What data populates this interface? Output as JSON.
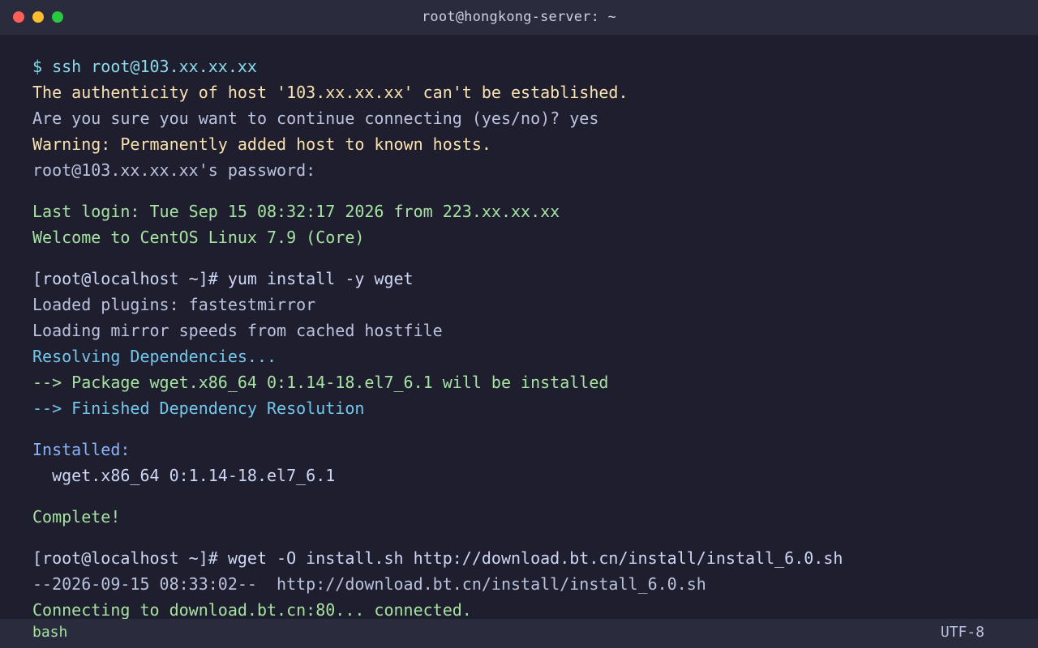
{
  "window": {
    "title": "root@hongkong-server: ~",
    "controls": {
      "close_color": "#ff5f57",
      "minimize_color": "#febc2e",
      "maximize_color": "#28c840"
    }
  },
  "terminal": {
    "lines": [
      {
        "text": "$ ssh root@103.xx.xx.xx",
        "style": "prompt"
      },
      {
        "text": "The authenticity of host '103.xx.xx.xx' can't be established.",
        "style": "warn"
      },
      {
        "text": "Are you sure you want to continue connecting (yes/no)? yes",
        "style": "normal"
      },
      {
        "text": "Warning: Permanently added host to known hosts.",
        "style": "warn"
      },
      {
        "text": "root@103.xx.xx.xx's password:",
        "style": "normal"
      },
      {
        "text": "Last login: Tue Sep 15 08:32:17 2026 from 223.xx.xx.xx",
        "style": "ok",
        "gap": true
      },
      {
        "text": "Welcome to CentOS Linux 7.9 (Core)",
        "style": "ok"
      },
      {
        "text": "[root@localhost ~]# yum install -y wget",
        "style": "cmd",
        "gap": true
      },
      {
        "text": "Loaded plugins: fastestmirror",
        "style": "normal"
      },
      {
        "text": "Loading mirror speeds from cached hostfile",
        "style": "normal"
      },
      {
        "text": "Resolving Dependencies...",
        "style": "info"
      },
      {
        "text": "--> Package wget.x86_64 0:1.14-18.el7_6.1 will be installed",
        "style": "ok"
      },
      {
        "text": "--> Finished Dependency Resolution",
        "style": "info"
      },
      {
        "text": "Installed:",
        "style": "head",
        "gap": true
      },
      {
        "text": "  wget.x86_64 0:1.14-18.el7_6.1",
        "style": "cmd"
      },
      {
        "text": "Complete!",
        "style": "ok",
        "gap": true
      },
      {
        "text": "[root@localhost ~]# wget -O install.sh http://download.bt.cn/install/install_6.0.sh",
        "style": "cmd",
        "gap": true
      },
      {
        "text": "--2026-09-15 08:33:02--  http://download.bt.cn/install/install_6.0.sh",
        "style": "normal"
      },
      {
        "text": "Connecting to download.bt.cn:80... connected.",
        "style": "ok"
      }
    ]
  },
  "statusbar": {
    "shell": "bash",
    "encoding": "UTF-8"
  }
}
